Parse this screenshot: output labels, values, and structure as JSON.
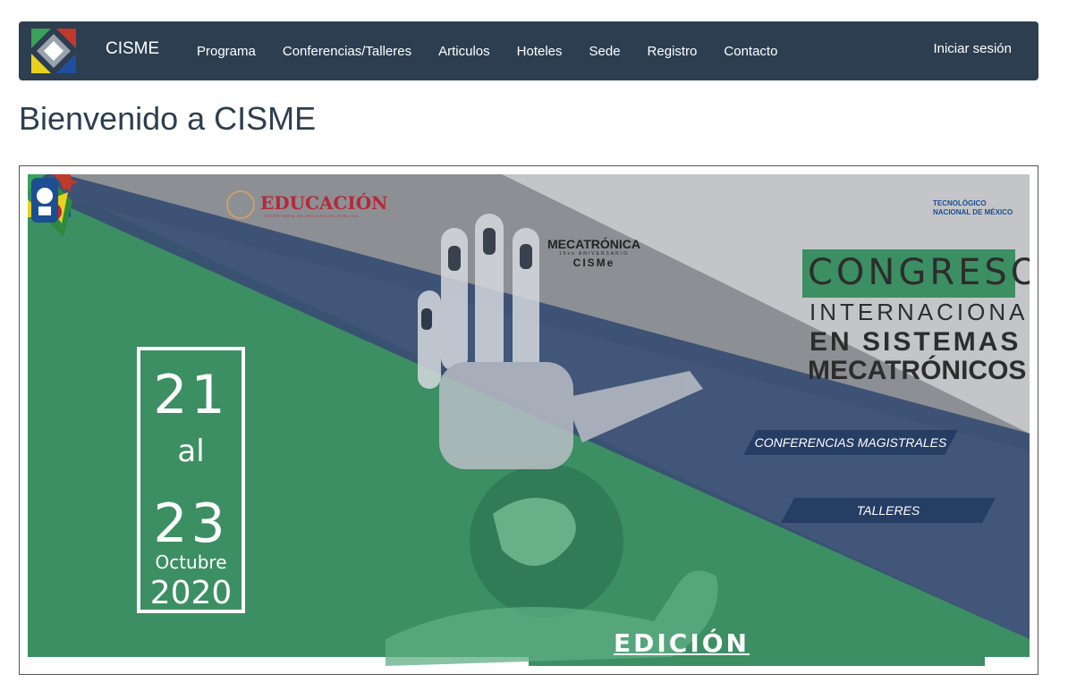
{
  "nav": {
    "brand": "CISME",
    "links": [
      "Programa",
      "Conferencias/Talleres",
      "Articulos",
      "Hoteles",
      "Sede",
      "Registro",
      "Contacto"
    ],
    "login": "Iniciar sesión"
  },
  "main": {
    "title": "Bienvenido a CISME"
  },
  "banner": {
    "educacion": "EDUCACIÓN",
    "educacion_sub": "SECRETARÍA DE EDUCACIÓN PÚBLICA",
    "mecatronica": "MECATRÓNICA",
    "mecatronica_sub": "15vo ANIVERSARIO",
    "cisme": "CISMe",
    "tec_line1": "TECNOLÓGICO",
    "tec_line2": "NACIONAL DE MÉXICO",
    "title_line1": "CONGRESO",
    "title_line2": "INTERNACIONAL",
    "title_line3": "EN SISTEMAS",
    "title_line4": "MECATRÓNICOS",
    "conferencias": "CONFERENCIAS MAGISTRALES",
    "talleres": "TALLERES",
    "date_start": "21",
    "date_al": "al",
    "date_end": "23",
    "month": "Octubre",
    "year": "2020",
    "edicion": "EDICIÓN"
  },
  "colors": {
    "navbar": "#2c3e50",
    "green": "#3c8f62",
    "navy_band": "#3a4f73",
    "pill": "#263d64",
    "red": "#b5283a"
  }
}
